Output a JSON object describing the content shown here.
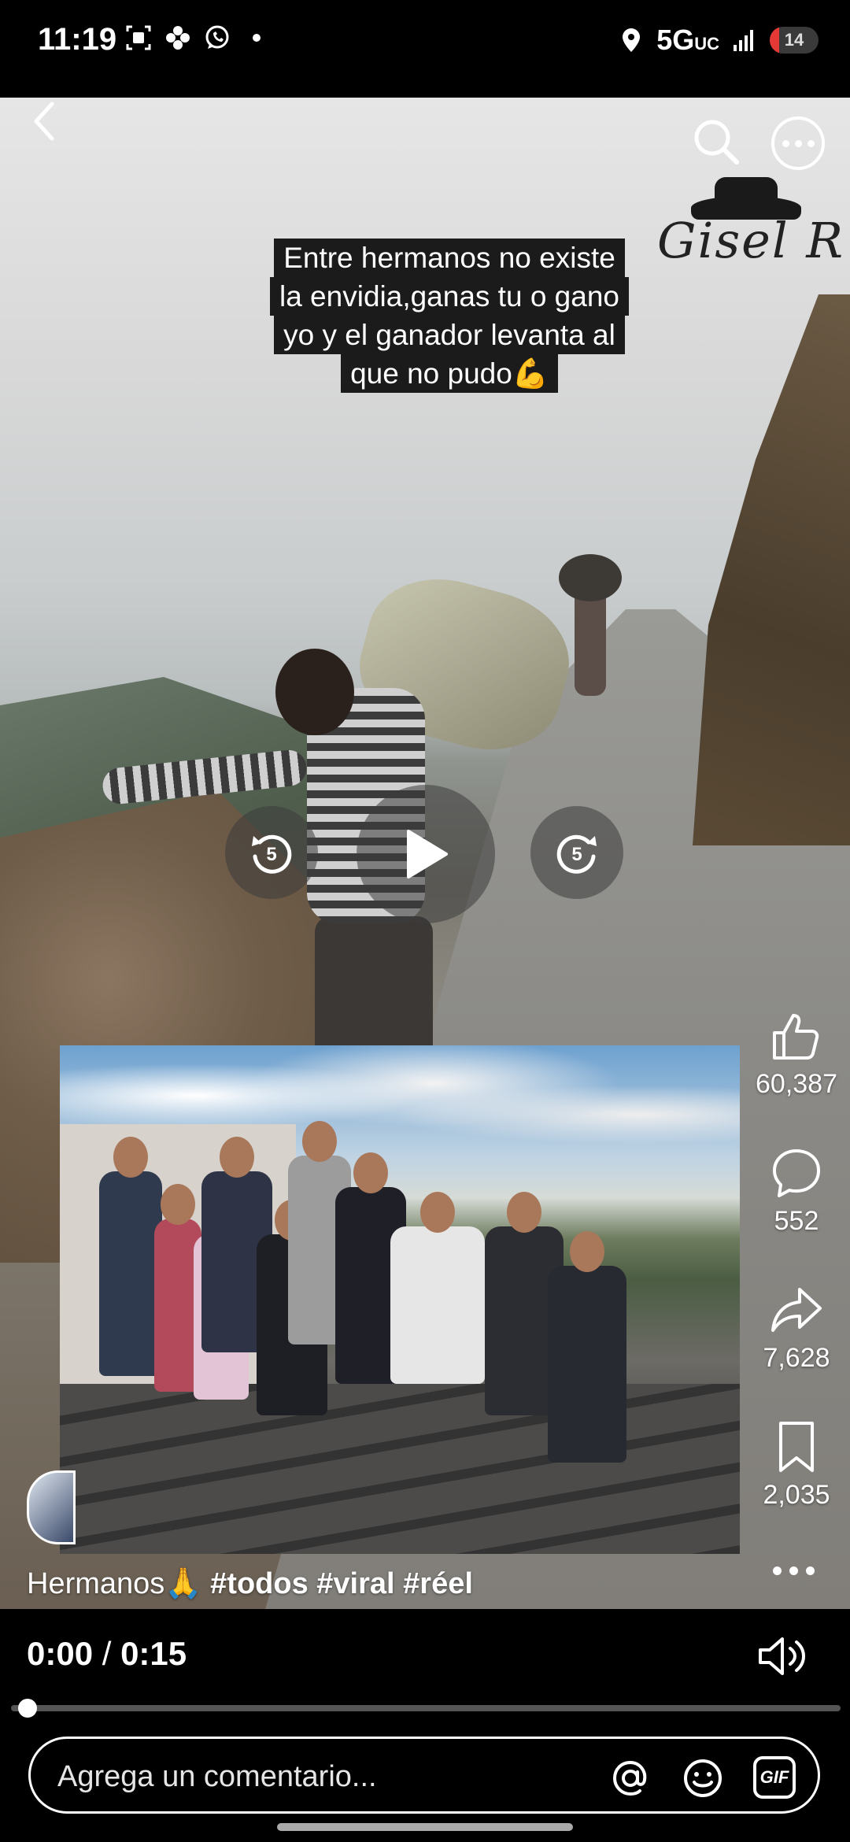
{
  "status_bar": {
    "time": "11:19",
    "network": "5G",
    "network_suffix": "UC",
    "battery": "14",
    "icons": [
      "screenshot-icon",
      "pinwheel-icon",
      "whatsapp-icon",
      "dot-icon",
      "location-icon",
      "signal-icon",
      "battery-icon"
    ]
  },
  "video": {
    "overlay_caption_lines": [
      "Entre hermanos no existe",
      "la envidia,ganas tu o gano",
      "yo y el ganador levanta al",
      "que no pudo💪"
    ],
    "watermark_text": "Gisel R",
    "controls": {
      "rewind_seconds": "5",
      "forward_seconds": "5"
    }
  },
  "actions": {
    "likes": "60,387",
    "comments": "552",
    "shares": "7,628",
    "saves": "2,035"
  },
  "reel": {
    "caption_text": "Hermanos🙏 ",
    "hashtags": "#todos #viral #réel"
  },
  "player": {
    "current_time": "0:00",
    "separator": " / ",
    "duration": "0:15",
    "progress_fraction": 0.01
  },
  "comment": {
    "placeholder": "Agrega un comentario...",
    "gif_label": "GIF"
  },
  "colors": {
    "background": "#000000",
    "foreground": "#ffffff",
    "battery_low": "#e53935"
  }
}
